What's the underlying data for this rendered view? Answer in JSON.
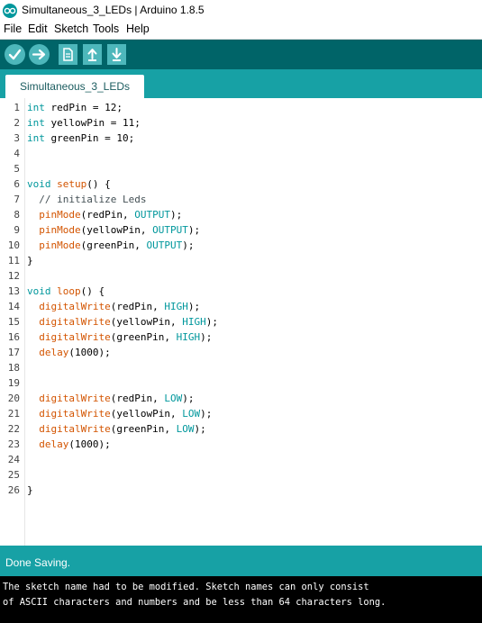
{
  "window": {
    "title": "Simultaneous_3_LEDs | Arduino 1.8.5"
  },
  "menu": [
    "File",
    "Edit",
    "Sketch",
    "Tools",
    "Help"
  ],
  "toolbar": {
    "buttons": [
      "check-icon",
      "arrow-right-icon",
      "new-file-icon",
      "open-upload-icon",
      "save-download-icon"
    ]
  },
  "tabs": [
    {
      "label": "Simultaneous_3_LEDs"
    }
  ],
  "editor": {
    "lines": [
      {
        "n": "1",
        "t": "int redPin = 12;"
      },
      {
        "n": "2",
        "t": "int yellowPin = 11;"
      },
      {
        "n": "3",
        "t": "int greenPin = 10;"
      },
      {
        "n": "4",
        "t": ""
      },
      {
        "n": "5",
        "t": ""
      },
      {
        "n": "6",
        "t": "void setup() {"
      },
      {
        "n": "7",
        "t": "  // initialize Leds"
      },
      {
        "n": "8",
        "t": "  pinMode(redPin, OUTPUT);"
      },
      {
        "n": "9",
        "t": "  pinMode(yellowPin, OUTPUT);"
      },
      {
        "n": "10",
        "t": "  pinMode(greenPin, OUTPUT);"
      },
      {
        "n": "11",
        "t": "}"
      },
      {
        "n": "12",
        "t": ""
      },
      {
        "n": "13",
        "t": "void loop() {"
      },
      {
        "n": "14",
        "t": "  digitalWrite(redPin, HIGH);"
      },
      {
        "n": "15",
        "t": "  digitalWrite(yellowPin, HIGH);"
      },
      {
        "n": "16",
        "t": "  digitalWrite(greenPin, HIGH);"
      },
      {
        "n": "17",
        "t": "  delay(1000);"
      },
      {
        "n": "18",
        "t": ""
      },
      {
        "n": "19",
        "t": ""
      },
      {
        "n": "20",
        "t": "  digitalWrite(redPin, LOW);"
      },
      {
        "n": "21",
        "t": "  digitalWrite(yellowPin, LOW);"
      },
      {
        "n": "22",
        "t": "  digitalWrite(greenPin, LOW);"
      },
      {
        "n": "23",
        "t": "  delay(1000);"
      },
      {
        "n": "24",
        "t": ""
      },
      {
        "n": "25",
        "t": ""
      },
      {
        "n": "26",
        "t": "}"
      }
    ]
  },
  "status": {
    "message": "Done Saving."
  },
  "console": {
    "lines": [
      "The sketch name had to be modified. Sketch names can only consist",
      "of ASCII characters and numbers and be less than 64 characters long."
    ]
  },
  "colors": {
    "toolbar_bg": "#006468",
    "tab_strip": "#17a1a5",
    "button": "#4db7bb",
    "keyword": "#00979c",
    "function": "#d35400",
    "console_bg": "#000000"
  }
}
